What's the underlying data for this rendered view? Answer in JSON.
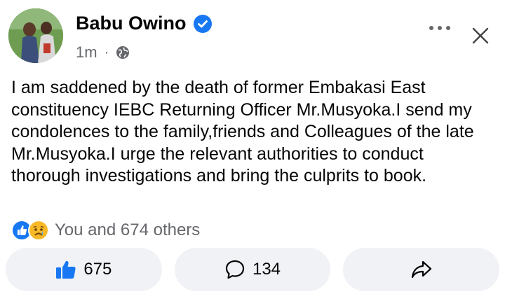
{
  "post": {
    "author": "Babu Owino",
    "timestamp": "1m",
    "separator": "·",
    "text": "I am saddened by the death of former Embakasi East constituency IEBC Returning Officer Mr.Musyoka.I send my condolences to the family,friends and Colleagues of the late Mr.Musyoka.I urge the relevant authorities to conduct thorough investigations and bring the culprits to book.",
    "reaction_summary": "You and 674 others"
  },
  "actions": {
    "like_count": "675",
    "comment_count": "134"
  },
  "colors": {
    "verified_blue": "#1877f2",
    "button_bg": "#f0f2f5",
    "meta_gray": "#65676b"
  },
  "icons": {
    "verified": "verified-badge-icon",
    "privacy": "globe-icon",
    "more": "more-dots-icon",
    "close": "close-icon",
    "like": "thumbs-up-icon",
    "comment": "comment-bubble-icon",
    "share": "share-arrow-icon",
    "reaction_like": "like-reaction-icon",
    "reaction_sad": "sad-reaction-icon"
  }
}
